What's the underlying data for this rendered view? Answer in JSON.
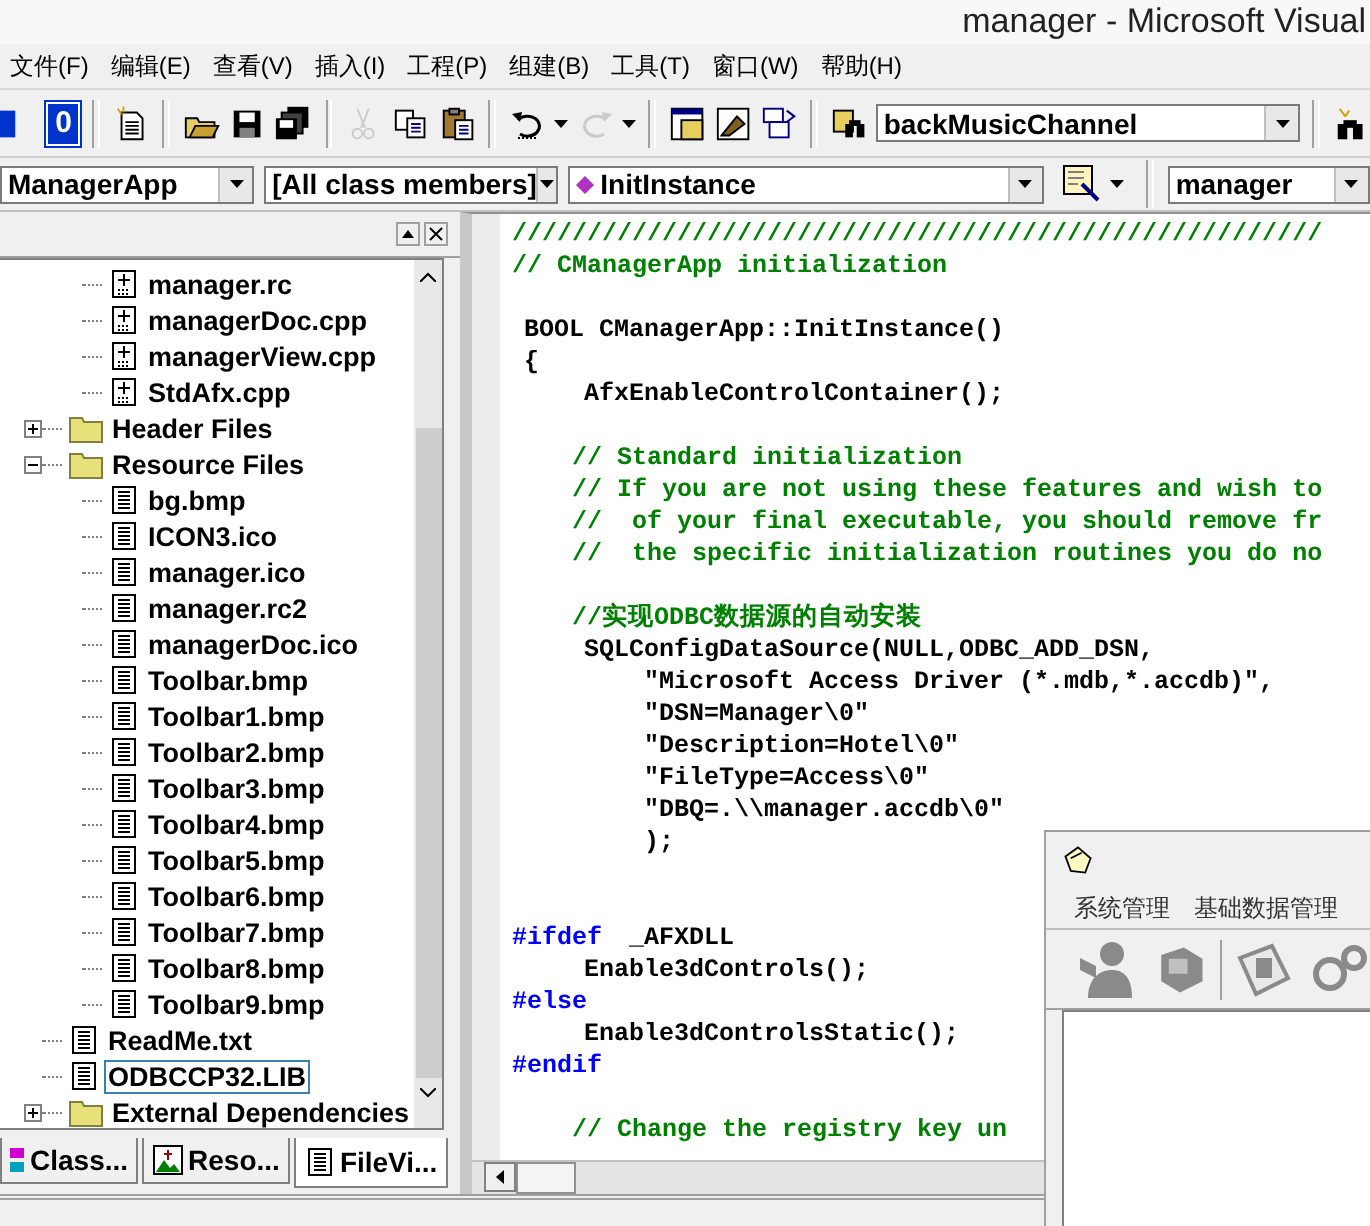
{
  "window": {
    "title": "manager - Microsoft Visual"
  },
  "menu": [
    "文件(F)",
    "编辑(E)",
    "查看(V)",
    "插入(I)",
    "工程(P)",
    "组建(B)",
    "工具(T)",
    "窗口(W)",
    "帮助(H)"
  ],
  "toolbar": [
    {
      "kind": "box",
      "disabled": false
    },
    {
      "kind": "number",
      "text": "0",
      "disabled": false
    },
    {
      "kind": "separator"
    },
    {
      "kind": "new-file",
      "disabled": false
    },
    {
      "kind": "separator"
    },
    {
      "kind": "open",
      "disabled": false
    },
    {
      "kind": "save",
      "disabled": false
    },
    {
      "kind": "save-all",
      "disabled": false
    },
    {
      "kind": "separator"
    },
    {
      "kind": "cut",
      "disabled": true
    },
    {
      "kind": "copy",
      "disabled": false
    },
    {
      "kind": "paste",
      "disabled": false
    },
    {
      "kind": "separator"
    },
    {
      "kind": "undo",
      "disabled": false
    },
    {
      "kind": "redo",
      "disabled": true
    },
    {
      "kind": "separator"
    },
    {
      "kind": "workspace",
      "disabled": false
    },
    {
      "kind": "output",
      "disabled": false
    },
    {
      "kind": "windows",
      "disabled": false
    },
    {
      "kind": "separator"
    },
    {
      "kind": "find-files",
      "disabled": false
    },
    {
      "kind": "combo",
      "text": "backMusicChannel",
      "disabled": false
    },
    {
      "kind": "separator"
    },
    {
      "kind": "find",
      "disabled": false
    }
  ],
  "wizard_bar": {
    "class_combo": "ManagerApp",
    "filter_combo": "[All class members]",
    "member_combo": {
      "text": "InitInstance",
      "kind": "member"
    },
    "project_combo": "manager"
  },
  "tree": {
    "items": [
      {
        "children": [
          {
            "label": "manager.rc",
            "kind": "source",
            "selected": false
          },
          {
            "label": "managerDoc.cpp",
            "kind": "source",
            "selected": false
          },
          {
            "label": "managerView.cpp",
            "kind": "source",
            "selected": false
          },
          {
            "label": "StdAfx.cpp",
            "kind": "source",
            "selected": false
          }
        ]
      },
      {
        "label": "Header Files",
        "kind": "folder",
        "expanded": false,
        "selected": false
      },
      {
        "label": "Resource Files",
        "kind": "folder",
        "expanded": true,
        "selected": false,
        "children": [
          {
            "label": "bg.bmp",
            "kind": "doc",
            "selected": false
          },
          {
            "label": "ICON3.ico",
            "kind": "doc",
            "selected": false
          },
          {
            "label": "manager.ico",
            "kind": "doc",
            "selected": false
          },
          {
            "label": "manager.rc2",
            "kind": "doc",
            "selected": false
          },
          {
            "label": "managerDoc.ico",
            "kind": "doc",
            "selected": false
          },
          {
            "label": "Toolbar.bmp",
            "kind": "doc",
            "selected": false
          },
          {
            "label": "Toolbar1.bmp",
            "kind": "doc",
            "selected": false
          },
          {
            "label": "Toolbar2.bmp",
            "kind": "doc",
            "selected": false
          },
          {
            "label": "Toolbar3.bmp",
            "kind": "doc",
            "selected": false
          },
          {
            "label": "Toolbar4.bmp",
            "kind": "doc",
            "selected": false
          },
          {
            "label": "Toolbar5.bmp",
            "kind": "doc",
            "selected": false
          },
          {
            "label": "Toolbar6.bmp",
            "kind": "doc",
            "selected": false
          },
          {
            "label": "Toolbar7.bmp",
            "kind": "doc",
            "selected": false
          },
          {
            "label": "Toolbar8.bmp",
            "kind": "doc",
            "selected": false
          },
          {
            "label": "Toolbar9.bmp",
            "kind": "doc",
            "selected": false
          }
        ]
      },
      {
        "label": "ReadMe.txt",
        "kind": "doc",
        "selected": false
      },
      {
        "label": "ODBCCP32.LIB",
        "kind": "doc",
        "selected": true
      },
      {
        "label": "External Dependencies",
        "kind": "folder",
        "expanded": false,
        "selected": false
      }
    ]
  },
  "workspace_tabs": [
    {
      "label": "Class...",
      "kind": "class",
      "selected": false
    },
    {
      "label": "Reso...",
      "kind": "resource",
      "selected": false
    },
    {
      "label": "FileVi...",
      "kind": "file",
      "selected": true
    }
  ],
  "code": [
    {
      "parts": [
        {
          "kind": "comment",
          "text": "//////////////////////////////////////////////////////"
        }
      ]
    },
    {
      "parts": [
        {
          "kind": "comment",
          "text": "// CManagerApp initialization"
        }
      ]
    },
    {
      "kind": "blank"
    },
    {
      "parts": [
        {
          "kind": "code",
          "text": "BOOL CManagerApp::InitInstance()"
        }
      ]
    },
    {
      "parts": [
        {
          "kind": "code",
          "text": "{"
        }
      ]
    },
    {
      "parts": [
        {
          "kind": "code",
          "text": "    AfxEnableControlContainer();"
        }
      ]
    },
    {
      "kind": "blank"
    },
    {
      "parts": [
        {
          "kind": "comment",
          "text": "    // Standard initialization"
        }
      ]
    },
    {
      "parts": [
        {
          "kind": "comment",
          "text": "    // If you are not using these features and wish to"
        }
      ]
    },
    {
      "parts": [
        {
          "kind": "comment",
          "text": "    //  of your final executable, you should remove fr"
        }
      ]
    },
    {
      "parts": [
        {
          "kind": "comment",
          "text": "    //  the specific initialization routines you do no"
        }
      ]
    },
    {
      "kind": "blank"
    },
    {
      "parts": [
        {
          "kind": "comment",
          "text": "    //实现ODBC数据源的自动安装"
        }
      ]
    },
    {
      "parts": [
        {
          "kind": "code",
          "text": "    SQLConfigDataSource(NULL,ODBC_ADD_DSN,"
        }
      ]
    },
    {
      "parts": [
        {
          "kind": "code",
          "text": "        \"Microsoft Access Driver (*.mdb,*.accdb)\","
        }
      ]
    },
    {
      "parts": [
        {
          "kind": "code",
          "text": "        \"DSN=Manager\\0\""
        }
      ]
    },
    {
      "parts": [
        {
          "kind": "code",
          "text": "        \"Description=Hotel\\0\""
        }
      ]
    },
    {
      "parts": [
        {
          "kind": "code",
          "text": "        \"FileType=Access\\0\""
        }
      ]
    },
    {
      "parts": [
        {
          "kind": "code",
          "text": "        \"DBQ=.\\\\manager.accdb\\0\""
        }
      ]
    },
    {
      "parts": [
        {
          "kind": "code",
          "text": "        );"
        }
      ]
    },
    {
      "kind": "blank"
    },
    {
      "kind": "blank"
    },
    {
      "parts": [
        {
          "kind": "directive",
          "text": "#ifdef"
        },
        {
          "kind": "code",
          "text": " _AFXDLL"
        }
      ]
    },
    {
      "parts": [
        {
          "kind": "code",
          "text": "    Enable3dControls();"
        }
      ]
    },
    {
      "parts": [
        {
          "kind": "directive",
          "text": "#else"
        }
      ]
    },
    {
      "parts": [
        {
          "kind": "code",
          "text": "    Enable3dControlsStatic();"
        }
      ]
    },
    {
      "parts": [
        {
          "kind": "directive",
          "text": "#endif"
        }
      ]
    },
    {
      "kind": "blank"
    },
    {
      "parts": [
        {
          "kind": "comment",
          "text": "    // Change the registry key un"
        }
      ]
    }
  ],
  "child_window": {
    "menu": [
      "系统管理",
      "基础数据管理"
    ],
    "tools": [
      {
        "kind": "person",
        "disabled": true
      },
      {
        "kind": "computer",
        "disabled": true
      },
      {
        "kind": "separator"
      },
      {
        "kind": "card",
        "disabled": true
      },
      {
        "kind": "gears",
        "disabled": true
      }
    ]
  }
}
